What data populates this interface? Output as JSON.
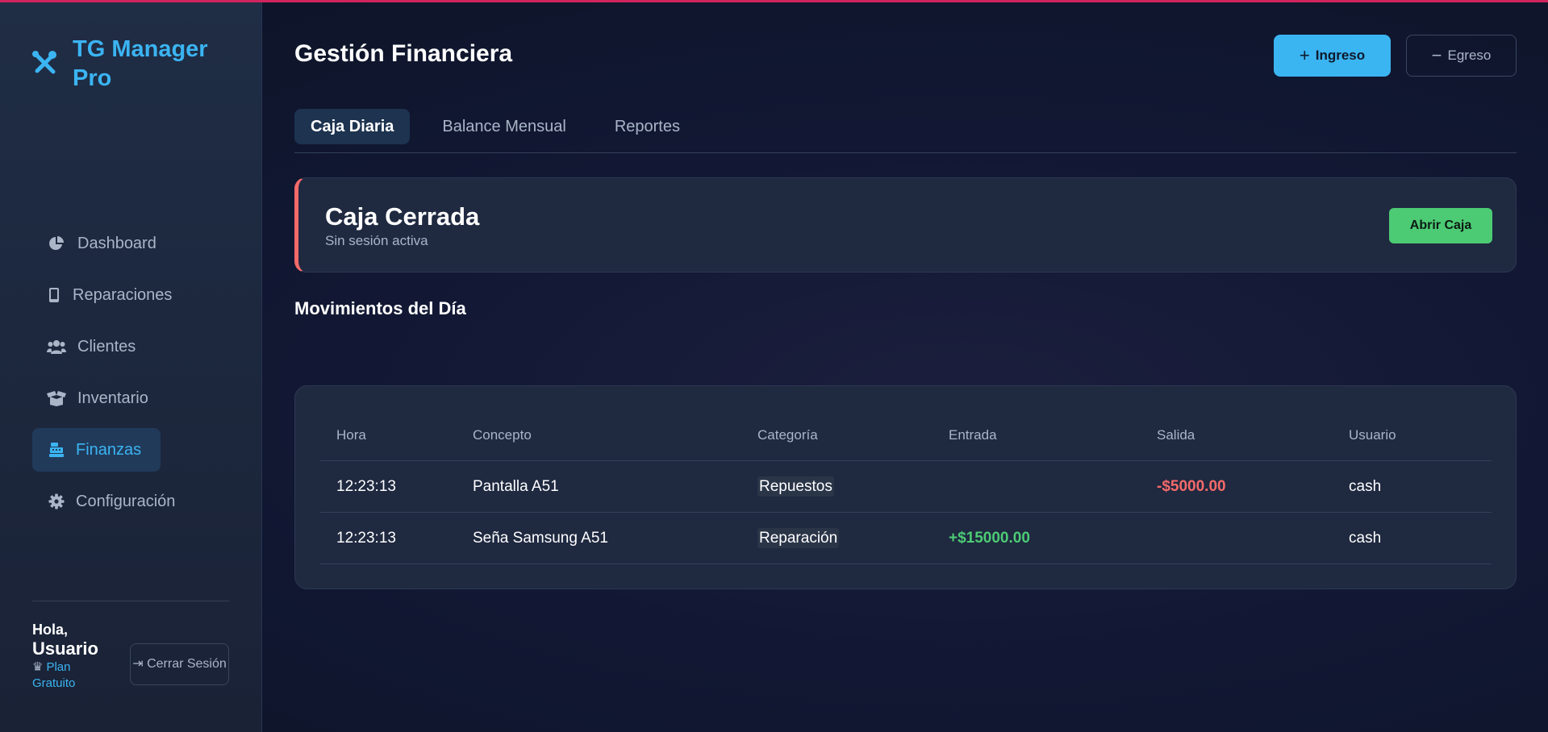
{
  "brand": {
    "name": "TG Manager Pro"
  },
  "sidebar": {
    "items": [
      {
        "label": "Dashboard",
        "icon": "chart-pie-icon"
      },
      {
        "label": "Reparaciones",
        "icon": "mobile-icon"
      },
      {
        "label": "Clientes",
        "icon": "users-icon"
      },
      {
        "label": "Inventario",
        "icon": "box-open-icon"
      },
      {
        "label": "Finanzas",
        "icon": "cash-register-icon",
        "active": true
      },
      {
        "label": "Configuración",
        "icon": "gear-icon"
      }
    ],
    "user": {
      "greeting": "Hola,",
      "name": "Usuario",
      "plan": "Plan Gratuito"
    },
    "logout_label": "Cerrar Sesión"
  },
  "header": {
    "title": "Gestión Financiera",
    "ingreso_label": "Ingreso",
    "egreso_label": "Egreso"
  },
  "tabs": [
    {
      "label": "Caja Diaria",
      "active": true
    },
    {
      "label": "Balance Mensual"
    },
    {
      "label": "Reportes"
    }
  ],
  "status": {
    "title": "Caja Cerrada",
    "subtitle": "Sin sesión activa",
    "action_label": "Abrir Caja"
  },
  "movements": {
    "title": "Movimientos del Día",
    "columns": [
      "Hora",
      "Concepto",
      "Categoría",
      "Entrada",
      "Salida",
      "Usuario"
    ],
    "rows": [
      {
        "hora": "12:23:13",
        "concepto": "Pantalla A51",
        "categoria": "Repuestos",
        "entrada": "",
        "salida": "-$5000.00",
        "usuario": "cash"
      },
      {
        "hora": "12:23:13",
        "concepto": "Seña Samsung A51",
        "categoria": "Reparación",
        "entrada": "+$15000.00",
        "salida": "",
        "usuario": "cash"
      }
    ]
  },
  "colors": {
    "accent": "#3bb4f2",
    "success": "#4ccb74",
    "danger": "#f56a6a",
    "topline": "#d0245e"
  }
}
